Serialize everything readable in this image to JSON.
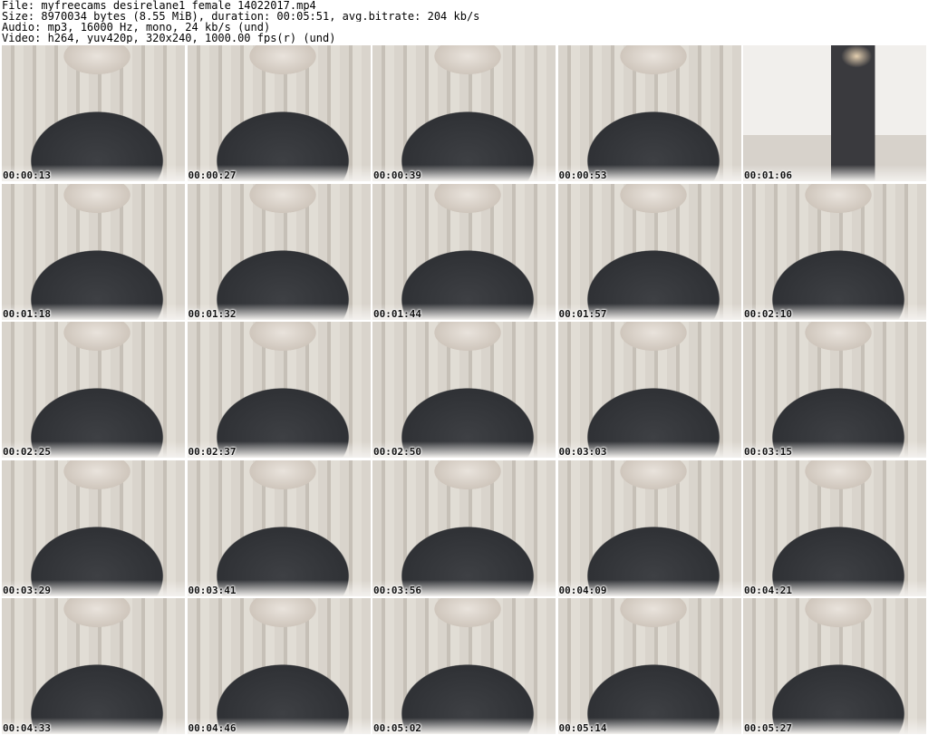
{
  "header": {
    "file": "File: myfreecams_desirelane1_female_14022017.mp4",
    "size": "Size: 8970034 bytes (8.55 MiB), duration: 00:05:51, avg.bitrate: 204 kb/s",
    "audio": "Audio: mp3, 16000 Hz, mono, 24 kb/s (und)",
    "video": "Video: h264, yuv420p, 320x240, 1000.00 fps(r) (und)"
  },
  "frames": [
    "00:00:13",
    "00:00:27",
    "00:00:39",
    "00:00:53",
    "00:01:06",
    "00:01:18",
    "00:01:32",
    "00:01:44",
    "00:01:57",
    "00:02:10",
    "00:02:25",
    "00:02:37",
    "00:02:50",
    "00:03:03",
    "00:03:15",
    "00:03:29",
    "00:03:41",
    "00:03:56",
    "00:04:09",
    "00:04:21",
    "00:04:33",
    "00:04:46",
    "00:05:02",
    "00:05:14",
    "00:05:27"
  ]
}
